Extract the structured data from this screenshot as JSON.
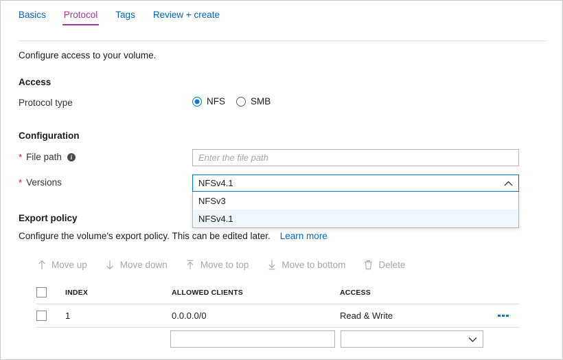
{
  "tabs": [
    {
      "label": "Basics",
      "active": false
    },
    {
      "label": "Protocol",
      "active": true
    },
    {
      "label": "Tags",
      "active": false
    },
    {
      "label": "Review + create",
      "active": false
    }
  ],
  "intro": "Configure access to your volume.",
  "access": {
    "heading": "Access",
    "protocol_label": "Protocol type",
    "options": [
      {
        "label": "NFS",
        "checked": true
      },
      {
        "label": "SMB",
        "checked": false
      }
    ]
  },
  "configuration": {
    "heading": "Configuration",
    "file_path": {
      "label": "File path",
      "required_marker": "*",
      "info_glyph": "i",
      "value": "",
      "placeholder": "Enter the file path"
    },
    "versions": {
      "label": "Versions",
      "required_marker": "*",
      "selected": "NFSv4.1",
      "expanded": true,
      "options": [
        {
          "label": "NFSv3",
          "selected": false
        },
        {
          "label": "NFSv4.1",
          "selected": true
        }
      ]
    }
  },
  "export_policy": {
    "heading": "Export policy",
    "description": "Configure the volume's export policy. This can be edited later.",
    "learn_more": "Learn more",
    "toolbar": [
      {
        "label": "Move up",
        "icon": "arrow-up-icon",
        "enabled": false
      },
      {
        "label": "Move down",
        "icon": "arrow-down-icon",
        "enabled": false
      },
      {
        "label": "Move to top",
        "icon": "arrow-to-top-icon",
        "enabled": false
      },
      {
        "label": "Move to bottom",
        "icon": "arrow-to-bottom-icon",
        "enabled": false
      },
      {
        "label": "Delete",
        "icon": "trash-icon",
        "enabled": false
      }
    ],
    "columns": {
      "index": "INDEX",
      "allowed_clients": "ALLOWED CLIENTS",
      "access": "ACCESS"
    },
    "rows": [
      {
        "checked": false,
        "index": "1",
        "allowed_clients": "0.0.0.0/0",
        "access": "Read & Write",
        "menu_icon": "more-options-icon"
      }
    ],
    "new_entry": {
      "client_value": "",
      "client_placeholder": "",
      "access_value": "",
      "access_placeholder": ""
    }
  },
  "colors": {
    "accent_tab": "#a4369c",
    "link": "#0066cc",
    "primary_blue": "#0078d4",
    "required_red": "#e00b1c",
    "option_highlight": "#eff6fc",
    "disabled_text": "#a6a6a6"
  }
}
